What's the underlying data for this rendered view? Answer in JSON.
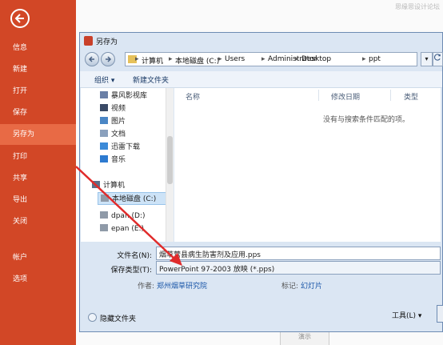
{
  "backstage": {
    "items": [
      {
        "label": "信息",
        "active": false
      },
      {
        "label": "新建",
        "active": false
      },
      {
        "label": "打开",
        "active": false
      },
      {
        "label": "保存",
        "active": false
      },
      {
        "label": "另存为",
        "active": true
      },
      {
        "label": "打印",
        "active": false
      },
      {
        "label": "共享",
        "active": false
      },
      {
        "label": "导出",
        "active": false
      },
      {
        "label": "关闭",
        "active": false
      },
      {
        "label": "帐户",
        "active": false
      },
      {
        "label": "选项",
        "active": false
      }
    ],
    "accent": "#d24726"
  },
  "watermark": "思缘思设计论坛",
  "dialog": {
    "title": "另存为",
    "breadcrumbs": [
      "计算机",
      "本地磁盘 (C:)",
      "Users",
      "Administrator",
      "Desktop",
      "ppt"
    ],
    "refresh_icon": "refresh-icon",
    "toolbar": {
      "organize": "组织 ▾",
      "new_folder": "新建文件夹"
    },
    "nav_tree": [
      {
        "label": "暴风影视库",
        "icon": "library-icon"
      },
      {
        "label": "视频",
        "icon": "video-icon"
      },
      {
        "label": "图片",
        "icon": "picture-icon"
      },
      {
        "label": "文档",
        "icon": "document-icon"
      },
      {
        "label": "迅雷下载",
        "icon": "download-icon"
      },
      {
        "label": "音乐",
        "icon": "music-icon"
      },
      {
        "label": "计算机",
        "icon": "computer-icon"
      },
      {
        "label": "本地磁盘 (C:)",
        "icon": "drive-icon"
      },
      {
        "label": "dpan (D:)",
        "icon": "drive-icon"
      },
      {
        "label": "epan (E:)",
        "icon": "drive-icon"
      }
    ],
    "columns": [
      "名称",
      "修改日期",
      "类型"
    ],
    "empty_message": "没有与搜索条件匹配的项。",
    "filename_label": "文件名(N):",
    "filename_value": "烟草营县病生防害剂及应用.pps",
    "filetype_label": "保存类型(T):",
    "filetype_value": "PowerPoint 97-2003 放映 (*.pps)",
    "author_label": "作者:",
    "author_value": "郑州烟草研究院",
    "tags_label": "标记:",
    "tags_value": "幻灯片",
    "hide_folders": "隐藏文件夹",
    "tools": "工具(L) ▾",
    "below_tab": "演示"
  }
}
